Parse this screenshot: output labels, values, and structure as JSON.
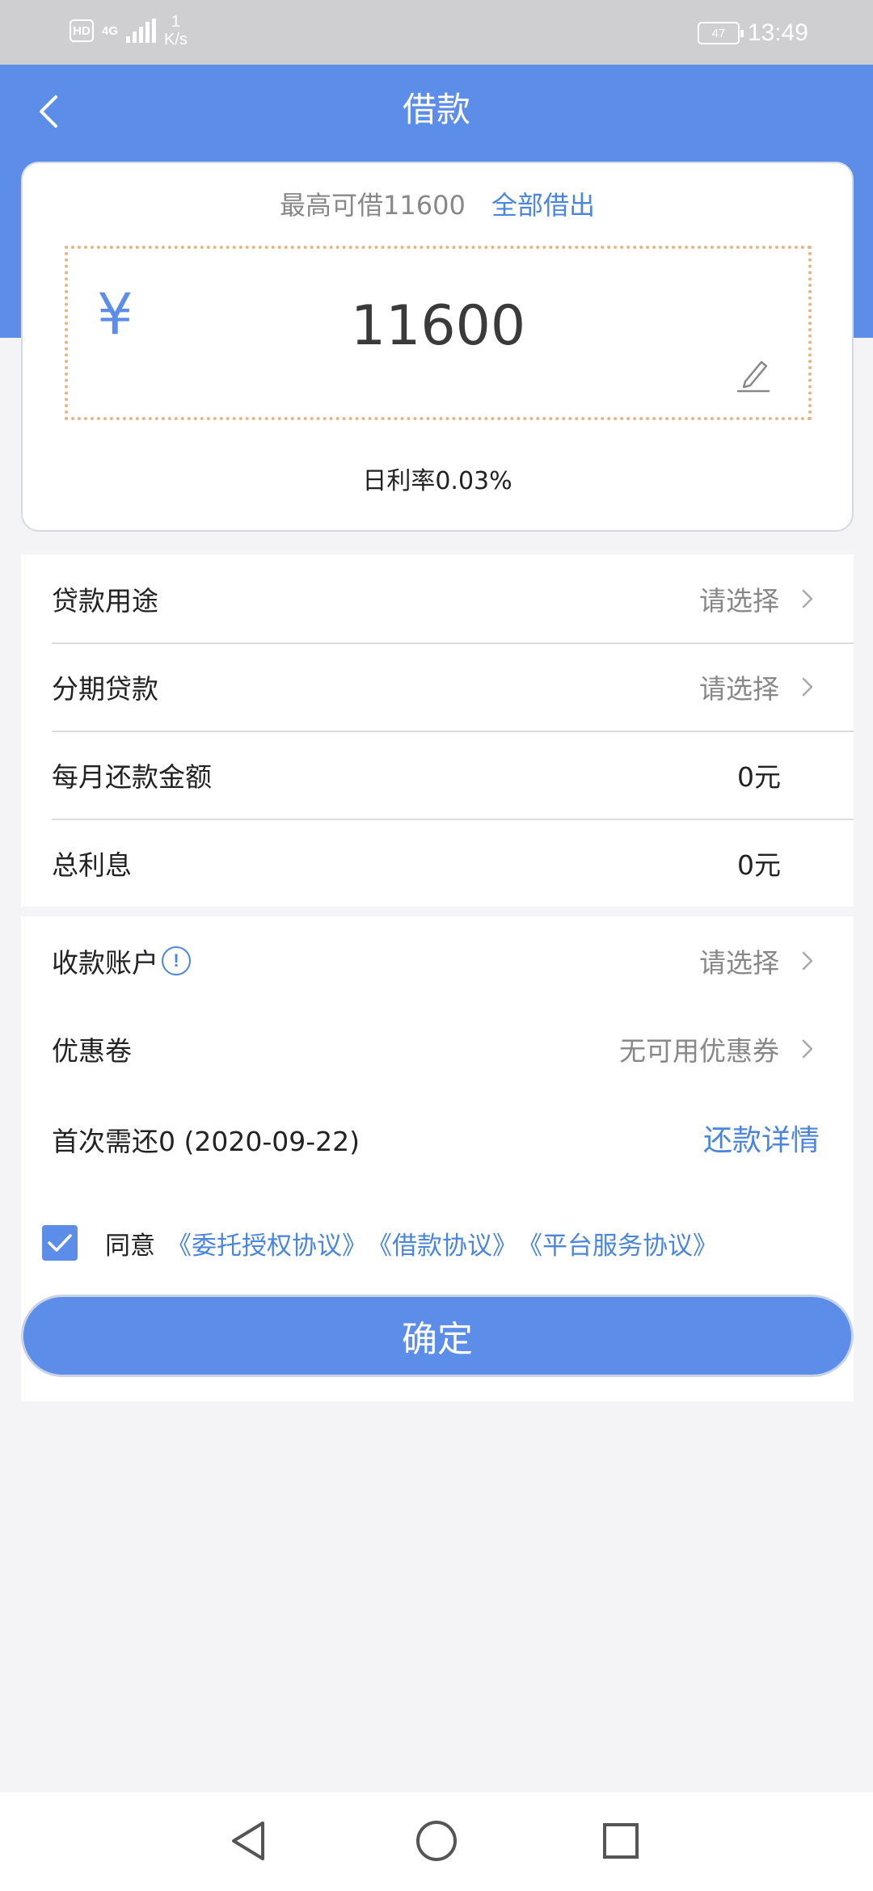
{
  "status_bar": {
    "hd": "HD",
    "network": "4G",
    "speed_value": "1",
    "speed_unit": "K/s",
    "battery": "47",
    "time": "13:49"
  },
  "header": {
    "title": "借款"
  },
  "card": {
    "limit_text": "最高可借11600",
    "borrow_all_label": "全部借出",
    "currency_symbol": "¥",
    "amount": "11600",
    "daily_rate": "日利率0.03%"
  },
  "loan_details": [
    {
      "label": "贷款用途",
      "value": "请选择"
    },
    {
      "label": "分期贷款",
      "value": "请选择"
    },
    {
      "label": "每月还款金额",
      "value": "0元"
    },
    {
      "label": "总利息",
      "value": "0元"
    }
  ],
  "account": {
    "receive_label": "收款账户",
    "receive_value": "请选择",
    "coupon_label": "优惠卷",
    "coupon_value": "无可用优惠券",
    "first_repayment": "首次需还0 (2020-09-22)",
    "repayment_detail_label": "还款详情"
  },
  "agreement": {
    "checked": true,
    "agree_label": "同意",
    "links": [
      "《委托授权协议》",
      "《借款协议》",
      "《平台服务协议》"
    ]
  },
  "confirm_label": "确定",
  "colors": {
    "primary": "#5b8de9",
    "link": "#4a86df",
    "dotted_border": "#e6b584"
  }
}
